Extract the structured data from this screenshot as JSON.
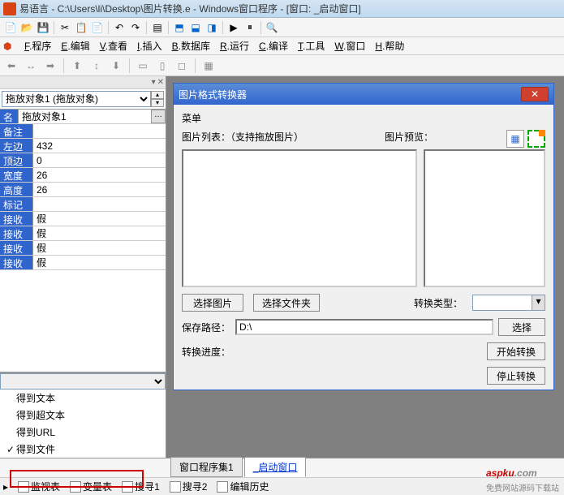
{
  "app_title": "易语言 - C:\\Users\\li\\Desktop\\图片转换.e - Windows窗口程序 - [窗口: _启动窗口]",
  "menus": [
    "F.程序",
    "E.编辑",
    "V.查看",
    "I.插入",
    "B.数据库",
    "R.运行",
    "C.编译",
    "T.工具",
    "W.窗口",
    "H.帮助"
  ],
  "obj_select": "拖放对象1 (拖放对象)",
  "properties": [
    {
      "label": "名称",
      "value": "拖放对象1",
      "btn": true
    },
    {
      "label": "备注",
      "value": ""
    },
    {
      "label": "左边",
      "value": "432"
    },
    {
      "label": "顶边",
      "value": "0"
    },
    {
      "label": "宽度",
      "value": "26"
    },
    {
      "label": "高度",
      "value": "26"
    },
    {
      "label": "标记",
      "value": ""
    },
    {
      "label": "接收文本",
      "value": "假"
    },
    {
      "label": "接收超文本",
      "value": "假"
    },
    {
      "label": "接收URL",
      "value": "假"
    },
    {
      "label": "接收文件",
      "value": "假"
    }
  ],
  "events": [
    {
      "label": "得到文本",
      "checked": false
    },
    {
      "label": "得到超文本",
      "checked": false
    },
    {
      "label": "得到URL",
      "checked": false
    },
    {
      "label": "得到文件",
      "checked": true
    }
  ],
  "inner_window": {
    "title": "图片格式转换器",
    "menu_label": "菜单",
    "list_label": "图片列表：（支持拖放图片）",
    "preview_label": "图片预览：",
    "btn_select_pic": "选择图片",
    "btn_select_folder": "选择文件夹",
    "convert_type_label": "转换类型：",
    "save_path_label": "保存路径：",
    "save_path_value": "D:\\",
    "btn_select": "选择",
    "progress_label": "转换进度：",
    "btn_start": "开始转换",
    "btn_stop": "停止转换"
  },
  "bottom_tabs": [
    {
      "label": "窗口程序集1",
      "active": false
    },
    {
      "label": "_启动窗口",
      "active": true
    }
  ],
  "status_items": [
    "监视表",
    "变量表",
    "搜寻1",
    "搜寻2",
    "编辑历史"
  ],
  "watermark": {
    "main": "aspku",
    "suffix": ".com",
    "sub": "免费网站源码下载站"
  }
}
